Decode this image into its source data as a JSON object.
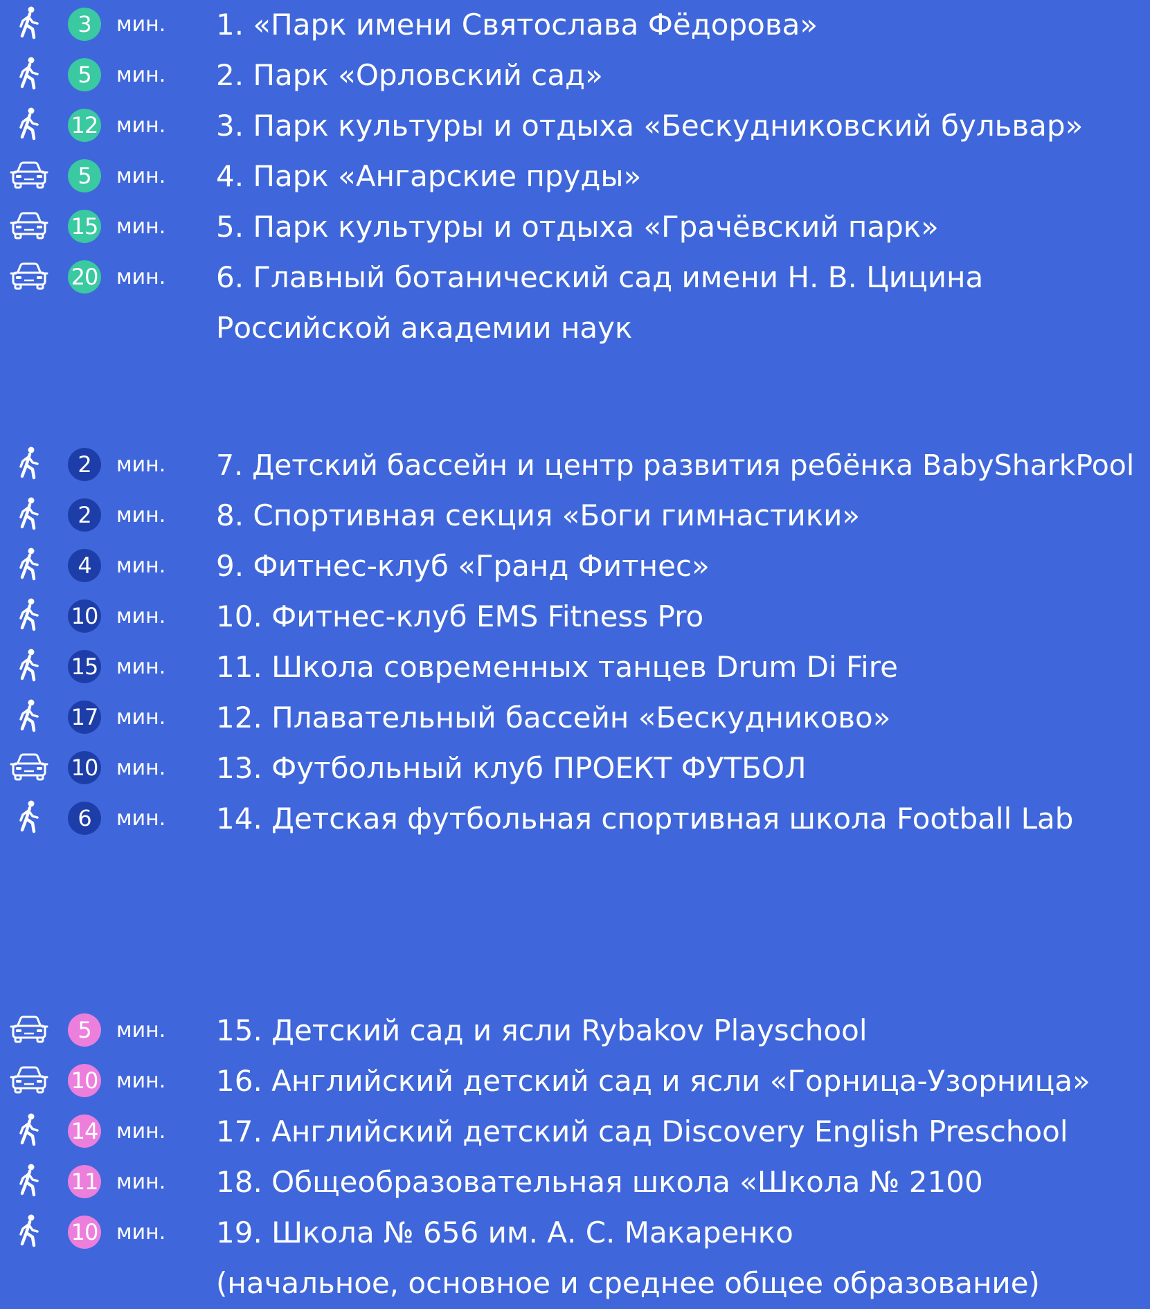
{
  "colors": {
    "background": "#3f67db",
    "parks_badge": "#3ac9a0",
    "sports_badge": "#1d3ea8",
    "schools_badge": "#ec7fdc"
  },
  "sections": [
    {
      "badge_color": "#3ac9a0",
      "items": [
        {
          "mode": "walk-icon",
          "minutes": "3",
          "unit": "мин.",
          "name": "1.  «Парк имени Святослава Фёдорова»"
        },
        {
          "mode": "walk-icon",
          "minutes": "5",
          "unit": "мин.",
          "name": "2. Парк «Орловский сад»"
        },
        {
          "mode": "walk-icon",
          "minutes": "12",
          "unit": "мин.",
          "name": "3. Парк культуры и отдыха «Бескудниковский бульвар»"
        },
        {
          "mode": "car-icon",
          "minutes": "5",
          "unit": "мин.",
          "name": "4. Парк «Ангарские пруды»"
        },
        {
          "mode": "car-icon",
          "minutes": "15",
          "unit": "мин.",
          "name": "5. Парк культуры и отдыха «Грачёвский парк»"
        },
        {
          "mode": "car-icon",
          "minutes": "20",
          "unit": "мин.",
          "name": "6. Главный ботанический сад имени Н. В. Цицина",
          "continuation": "Российской академии наук"
        }
      ]
    },
    {
      "badge_color": "#1d3ea8",
      "items": [
        {
          "mode": "walk-icon",
          "minutes": "2",
          "unit": "мин.",
          "name": "7. Детский бассейн и центр развития ребёнка BabySharkPool"
        },
        {
          "mode": "walk-icon",
          "minutes": "2",
          "unit": "мин.",
          "name": "8. Спортивная секция «Боги гимнастики»"
        },
        {
          "mode": "walk-icon",
          "minutes": "4",
          "unit": "мин.",
          "name": "9. Фитнес-клуб «Гранд Фитнес»"
        },
        {
          "mode": "walk-icon",
          "minutes": "10",
          "unit": "мин.",
          "name": "10. Фитнес-клуб EMS Fitness Pro"
        },
        {
          "mode": "walk-icon",
          "minutes": "15",
          "unit": "мин.",
          "name": "11. Школа современных танцев Drum Di Fire"
        },
        {
          "mode": "walk-icon",
          "minutes": "17",
          "unit": "мин.",
          "name": "12. Плавательный бассейн «Бескудниково»"
        },
        {
          "mode": "car-icon",
          "minutes": "10",
          "unit": "мин.",
          "name": "13. Футбольный клуб ПРОЕКТ ФУТБОЛ"
        },
        {
          "mode": "walk-icon",
          "minutes": "6",
          "unit": "мин.",
          "name": "14. Детская футбольная спортивная школа Football Lab"
        }
      ]
    },
    {
      "badge_color": "#ec7fdc",
      "items": [
        {
          "mode": "car-icon",
          "minutes": "5",
          "unit": "мин.",
          "name": "15. Детский сад и ясли Rybakov Playschool"
        },
        {
          "mode": "car-icon",
          "minutes": "10",
          "unit": "мин.",
          "name": "16. Английский детский сад и ясли «Горница-Узорница»"
        },
        {
          "mode": "walk-icon",
          "minutes": "14",
          "unit": "мин.",
          "name": "17. Английский детский сад Discovery English Preschool"
        },
        {
          "mode": "walk-icon",
          "minutes": "11",
          "unit": "мин.",
          "name": "18. Общеобразовательная школа «Школа № 2100"
        },
        {
          "mode": "walk-icon",
          "minutes": "10",
          "unit": "мин.",
          "name": "19. Школа № 656 им. А. С. Макаренко",
          "continuation": "(начальное, основное и среднее общее образование)"
        }
      ]
    }
  ]
}
